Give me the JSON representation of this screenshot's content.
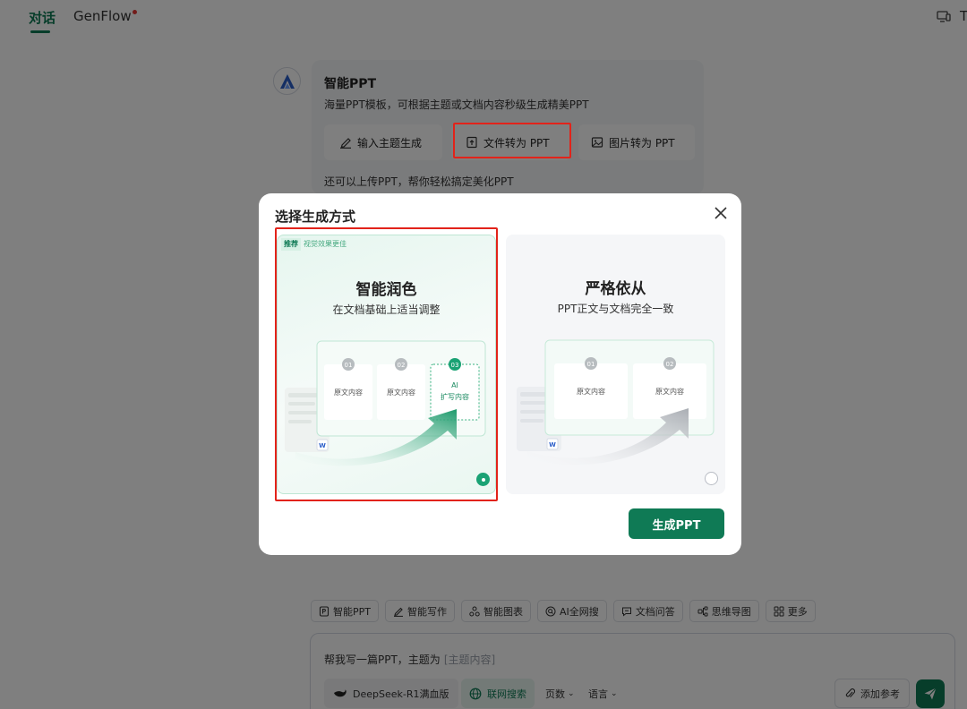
{
  "topbar": {
    "tab_chat": "对话",
    "tab_genflow": "GenFlow",
    "right_letter": "T"
  },
  "assistant": {
    "title": "智能PPT",
    "description": "海量PPT模板，可根据主题或文档内容秒级生成精美PPT",
    "options": {
      "topic": "输入主题生成",
      "file": "文件转为 PPT",
      "image": "图片转为 PPT"
    },
    "hint": "还可以上传PPT，帮你轻松搞定美化PPT"
  },
  "modal": {
    "title": "选择生成方式",
    "smart": {
      "tag": "推荐",
      "tag_note": "视觉效果更佳",
      "title": "智能润色",
      "subtitle": "在文档基础上适当调整",
      "selected": true,
      "steps": [
        "01",
        "02",
        "03"
      ],
      "cards": [
        "原文内容",
        "原文内容",
        "AI",
        "扩写内容"
      ],
      "doc_badge": "W"
    },
    "strict": {
      "title": "严格依从",
      "subtitle": "PPT正文与文档完全一致",
      "selected": false,
      "steps": [
        "01",
        "02"
      ],
      "cards": [
        "原文内容",
        "原文内容"
      ],
      "doc_badge": "W"
    },
    "generate_label": "生成PPT"
  },
  "tools": {
    "ppt": "智能PPT",
    "write": "智能写作",
    "chart": "智能图表",
    "search": "AI全网搜",
    "docqa": "文档问答",
    "mindmap": "思维导图",
    "more": "更多"
  },
  "input": {
    "prompt": "帮我写一篇PPT，主题为",
    "slot": "[主题内容]",
    "model": "DeepSeek-R1满血版",
    "web_search": "联网搜索",
    "pages": "页数",
    "language": "语言",
    "add_reference": "添加参考"
  },
  "colors": {
    "accent": "#0f7a55",
    "highlight_box": "#e2231a"
  }
}
